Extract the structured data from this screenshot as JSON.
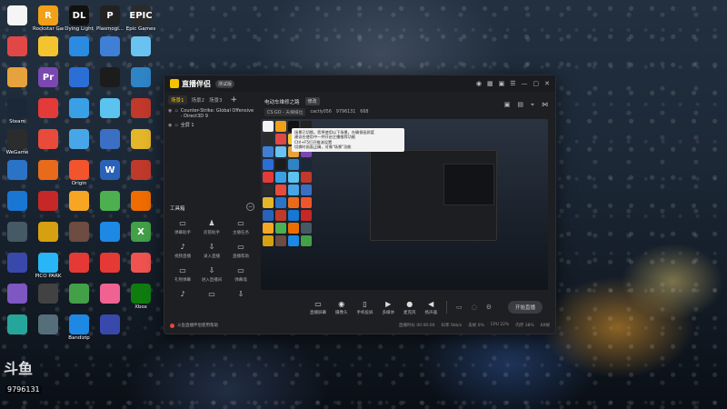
{
  "desktop": {
    "icons": [
      {
        "label": "",
        "color": "#f5f5f5",
        "glyph": ""
      },
      {
        "label": "Rockstar Games",
        "color": "#f1a017",
        "glyph": "R"
      },
      {
        "label": "Dying Light",
        "color": "#111111",
        "glyph": "DL"
      },
      {
        "label": "Plasmogl...",
        "color": "#222222",
        "glyph": "P"
      },
      {
        "label": "Epic Games",
        "color": "#2b2b2b",
        "glyph": "EPIC"
      },
      {
        "label": "",
        "color": "#e04848",
        "glyph": ""
      },
      {
        "label": "",
        "color": "#f4c430",
        "glyph": ""
      },
      {
        "label": "",
        "color": "#2a8be0",
        "glyph": ""
      },
      {
        "label": "",
        "color": "#3f7fd6",
        "glyph": ""
      },
      {
        "label": "",
        "color": "#6ac2f0",
        "glyph": ""
      },
      {
        "label": "",
        "color": "#e6a23c",
        "glyph": ""
      },
      {
        "label": "",
        "color": "#7b48b2",
        "glyph": "Pr"
      },
      {
        "label": "",
        "color": "#2b6fd6",
        "glyph": ""
      },
      {
        "label": "",
        "color": "#1c1c1c",
        "glyph": ""
      },
      {
        "label": "",
        "color": "#2f84c5",
        "glyph": ""
      },
      {
        "label": "Steam",
        "color": "#1b2838",
        "glyph": ""
      },
      {
        "label": "",
        "color": "#e33a3a",
        "glyph": ""
      },
      {
        "label": "",
        "color": "#3aa0e6",
        "glyph": ""
      },
      {
        "label": "",
        "color": "#5cc2f0",
        "glyph": ""
      },
      {
        "label": "",
        "color": "#c0392b",
        "glyph": ""
      },
      {
        "label": "WeGame",
        "color": "#2c2c2c",
        "glyph": ""
      },
      {
        "label": "",
        "color": "#e84b3c",
        "glyph": ""
      },
      {
        "label": "",
        "color": "#46a6e8",
        "glyph": ""
      },
      {
        "label": "",
        "color": "#3a6fc4",
        "glyph": ""
      },
      {
        "label": "",
        "color": "#e4b62a",
        "glyph": ""
      },
      {
        "label": "",
        "color": "#2b73c6",
        "glyph": ""
      },
      {
        "label": "",
        "color": "#e86b1c",
        "glyph": ""
      },
      {
        "label": "Origin",
        "color": "#f2542d",
        "glyph": ""
      },
      {
        "label": "",
        "color": "#2a62b8",
        "glyph": "W"
      },
      {
        "label": "",
        "color": "#c0392b",
        "glyph": ""
      },
      {
        "label": "",
        "color": "#1976d2",
        "glyph": ""
      },
      {
        "label": "",
        "color": "#c62828",
        "glyph": ""
      },
      {
        "label": "",
        "color": "#f6a623",
        "glyph": ""
      },
      {
        "label": "",
        "color": "#4caf50",
        "glyph": ""
      },
      {
        "label": "",
        "color": "#ef6c00",
        "glyph": ""
      },
      {
        "label": "",
        "color": "#455a64",
        "glyph": ""
      },
      {
        "label": "",
        "color": "#d6a010",
        "glyph": ""
      },
      {
        "label": "",
        "color": "#6d4c41",
        "glyph": ""
      },
      {
        "label": "",
        "color": "#1e88e5",
        "glyph": ""
      },
      {
        "label": "",
        "color": "#43a047",
        "glyph": "X"
      },
      {
        "label": "",
        "color": "#3949ab",
        "glyph": ""
      },
      {
        "label": "PICO PARK",
        "color": "#29b6f6",
        "glyph": ""
      },
      {
        "label": "",
        "color": "#e53935",
        "glyph": ""
      },
      {
        "label": "",
        "color": "#e53935",
        "glyph": ""
      },
      {
        "label": "",
        "color": "#ef5350",
        "glyph": ""
      },
      {
        "label": "",
        "color": "#7e57c2",
        "glyph": ""
      },
      {
        "label": "",
        "color": "#424242",
        "glyph": ""
      },
      {
        "label": "",
        "color": "#43a047",
        "glyph": ""
      },
      {
        "label": "",
        "color": "#f06292",
        "glyph": ""
      },
      {
        "label": "Xbox",
        "color": "#107c10",
        "glyph": ""
      },
      {
        "label": "",
        "color": "#26a69a",
        "glyph": ""
      },
      {
        "label": "",
        "color": "#546e7a",
        "glyph": ""
      },
      {
        "label": "Bandizip",
        "color": "#1e88e5",
        "glyph": ""
      },
      {
        "label": "",
        "color": "#3949ab",
        "glyph": ""
      }
    ],
    "douyu_logo": "斗鱼",
    "room_id": "9796131"
  },
  "app": {
    "brand": "直播伴侣",
    "version_badge": "测试版",
    "scene_tabs": [
      "场景1",
      "场景2",
      "场景3"
    ],
    "scene_add": "+",
    "sources": [
      {
        "name": "Counter-Strike: Global Offensive - Direct3D 9"
      },
      {
        "name": "全屏 1"
      }
    ],
    "tools_title": "工具箱",
    "tools": [
      {
        "icon": "▭",
        "label": "弹幕助手"
      },
      {
        "icon": "♟",
        "label": "房管助手"
      },
      {
        "icon": "▭",
        "label": "主播任务"
      },
      {
        "icon": "♪",
        "label": "视频直播"
      },
      {
        "icon": "⇩",
        "label": "录入直播"
      },
      {
        "icon": "▭",
        "label": "直播帮助"
      },
      {
        "icon": "▭",
        "label": "礼物弹幕"
      },
      {
        "icon": "⇩",
        "label": "进入直播间"
      },
      {
        "icon": "▭",
        "label": "弹幕墙"
      },
      {
        "icon": "♪",
        "label": ""
      },
      {
        "icon": "▭",
        "label": ""
      },
      {
        "icon": "⇩",
        "label": ""
      }
    ],
    "ad_text": "斗鱼直播伴侣使用帮助",
    "stream_title": "电动车维修之路",
    "stream_tag": "修改",
    "stream_meta": [
      "CS:GO - 天梯排位",
      "cactly056",
      "9796131",
      "668"
    ],
    "controls": [
      {
        "icon": "▭",
        "label": "直播屏幕"
      },
      {
        "icon": "◉",
        "label": "摄像头"
      },
      {
        "icon": "▭",
        "label": "手机投屏"
      },
      {
        "icon": "▶",
        "label": "多媒体"
      },
      {
        "icon": "●",
        "label": "麦克风"
      },
      {
        "icon": "◀",
        "label": "扬声器"
      }
    ],
    "go_live": "开始直播",
    "status": [
      "直播时长 00:00:00",
      "码率 0kb/s",
      "丢帧 0%",
      "CPU 22%",
      "内存 38%",
      "60帧"
    ],
    "tooltip": [
      "场景已切换。您将使用以下场景，在确保画质度",
      "建议在使用中一并开启主播推荐功能",
      "Ctrl+F5打开推流设置",
      "切换时画面正确，对像\"场景\"功能"
    ]
  }
}
